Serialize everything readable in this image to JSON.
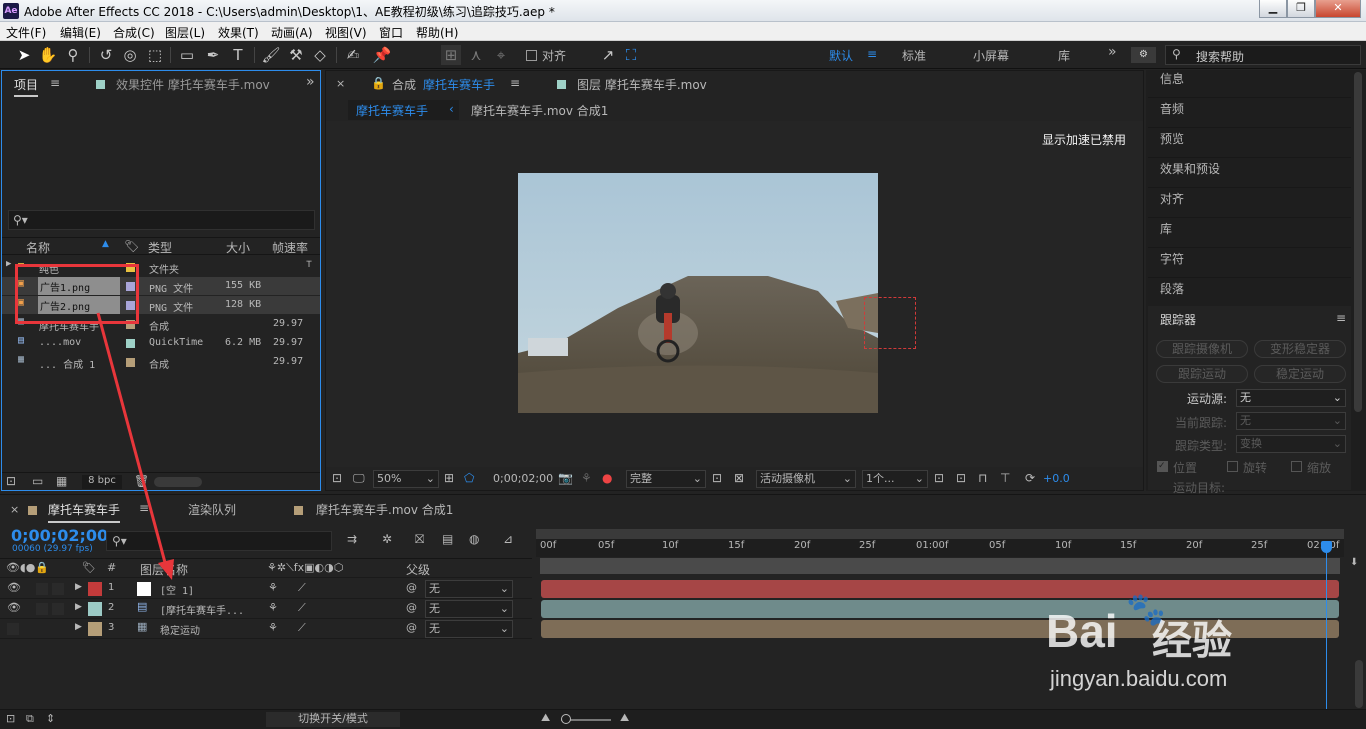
{
  "window": {
    "title": "Adobe After Effects CC 2018 - C:\\Users\\admin\\Desktop\\1、AE教程初级\\练习\\追踪技巧.aep *",
    "app_icon": "Ae"
  },
  "menu": [
    "文件(F)",
    "编辑(E)",
    "合成(C)",
    "图层(L)",
    "效果(T)",
    "动画(A)",
    "视图(V)",
    "窗口",
    "帮助(H)"
  ],
  "toolbar": {
    "align_label": "对齐",
    "workspaces": [
      "默认",
      "标准",
      "小屏幕",
      "库"
    ],
    "search_placeholder": "搜索帮助",
    "more": "»"
  },
  "project_panel": {
    "tab": "项目",
    "effects_tab": "效果控件 摩托车赛车手.mov",
    "search_placeholder": "",
    "columns": [
      "名称",
      "类型",
      "大小",
      "帧速率"
    ],
    "items": [
      {
        "name": "纯色",
        "type": "文件夹",
        "size": "",
        "fps": "",
        "color": "#e8c140"
      },
      {
        "name": "广告1.png",
        "type": "PNG 文件",
        "size": "155 KB",
        "fps": "",
        "color": "#a9a5d9"
      },
      {
        "name": "广告2.png",
        "type": "PNG 文件",
        "size": "128 KB",
        "fps": "",
        "color": "#a9a5d9"
      },
      {
        "name": "摩托车赛车手",
        "type": "合成",
        "size": "",
        "fps": "29.97",
        "color": "#b59e78"
      },
      {
        "name": "....mov",
        "type": "QuickTime",
        "size": "6.2 MB",
        "fps": "29.97",
        "color": "#9ed1c7"
      },
      {
        "name": "... 合成 1",
        "type": "合成",
        "size": "",
        "fps": "29.97",
        "color": "#b59e78"
      }
    ],
    "bpc": "8 bpc"
  },
  "comp_panel": {
    "tab_prefix": "合成",
    "tab_name": "摩托车赛车手",
    "layer_tab": "图层 摩托车赛车手.mov",
    "crumb1": "摩托车赛车手",
    "crumb2": "摩托车赛车手.mov 合成1",
    "accel_msg": "显示加速已禁用",
    "zoom": "50%",
    "timecode": "0;00;02;00",
    "quality": "完整",
    "camera": "活动摄像机",
    "views": "1个...",
    "exposure": "+0.0"
  },
  "right_panel": {
    "items": [
      "信息",
      "音频",
      "预览",
      "效果和预设",
      "对齐",
      "库",
      "字符",
      "段落"
    ],
    "tracker": {
      "title": "跟踪器",
      "buttons": [
        "跟踪摄像机",
        "变形稳定器",
        "跟踪运动",
        "稳定运动"
      ],
      "motion_source_label": "运动源:",
      "motion_source": "无",
      "current_track_label": "当前跟踪:",
      "current_track": "无",
      "track_type_label": "跟踪类型:",
      "track_type": "变换",
      "checks": [
        "位置",
        "旋转",
        "缩放"
      ],
      "target_label": "运动目标:"
    }
  },
  "timeline": {
    "tabs": [
      "摩托车赛车手",
      "渲染队列",
      "摩托车赛车手.mov 合成1"
    ],
    "timecode": "0;00;02;00",
    "frames": "00060 (29.97 fps)",
    "search_placeholder": "",
    "header_num": "#",
    "header_name": "图层名称",
    "header_parent": "父级",
    "layers": [
      {
        "num": "1",
        "name": "[空 1]",
        "parent": "无",
        "color": "#c33b3b",
        "bar": "#a64646"
      },
      {
        "num": "2",
        "name": "[摩托车赛车手...",
        "parent": "无",
        "color": "#9ccac5",
        "bar": "#6f8b8b"
      },
      {
        "num": "3",
        "name": "稳定运动",
        "parent": "无",
        "color": "#b59e78",
        "bar": "#7e6d57"
      }
    ],
    "ruler": [
      "00f",
      "05f",
      "10f",
      "15f",
      "20f",
      "25f",
      "01:00f",
      "05f",
      "10f",
      "15f",
      "20f",
      "25f",
      "02:00f"
    ],
    "toggle_label": "切换开关/模式"
  },
  "watermark": {
    "brand": "Bai",
    "brand2": "经验",
    "url": "jingyan.baidu.com"
  }
}
